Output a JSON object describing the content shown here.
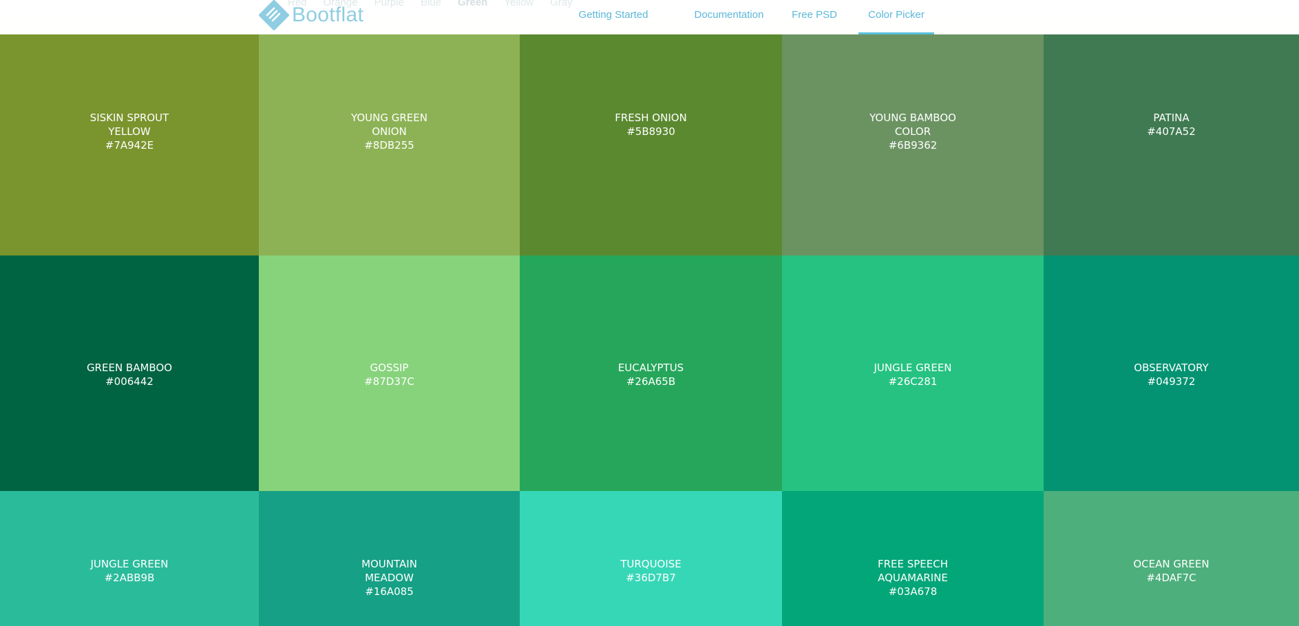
{
  "nav": {
    "brand": "Bootflat",
    "links": [
      {
        "label": "Getting Started"
      },
      {
        "label": "Documentation"
      },
      {
        "label": "Free PSD"
      },
      {
        "label": "Color Picker",
        "active": true
      }
    ],
    "filters": [
      "Red",
      "Orange",
      "Purple",
      "Blue",
      "Green",
      "Yellow",
      "Gray"
    ],
    "active_filter": "Green"
  },
  "swatches": [
    {
      "name": "SISKIN SPROUT YELLOW",
      "hex": "#7A942E"
    },
    {
      "name": "YOUNG GREEN ONION",
      "hex": "#8DB255"
    },
    {
      "name": "FRESH ONION",
      "hex": "#5B8930"
    },
    {
      "name": "YOUNG BAMBOO COLOR",
      "hex": "#6B9362"
    },
    {
      "name": "PATINA",
      "hex": "#407A52"
    },
    {
      "name": "GREEN BAMBOO",
      "hex": "#006442"
    },
    {
      "name": "GOSSIP",
      "hex": "#87D37C"
    },
    {
      "name": "EUCALYPTUS",
      "hex": "#26A65B"
    },
    {
      "name": "JUNGLE GREEN",
      "hex": "#26C281"
    },
    {
      "name": "OBSERVATORY",
      "hex": "#049372"
    },
    {
      "name": "JUNGLE GREEN",
      "hex": "#2ABB9B"
    },
    {
      "name": "MOUNTAIN MEADOW",
      "hex": "#16A085"
    },
    {
      "name": "TURQUOISE",
      "hex": "#36D7B7"
    },
    {
      "name": "FREE SPEECH AQUAMARINE",
      "hex": "#03A678"
    },
    {
      "name": "OCEAN GREEN",
      "hex": "#4DAF7C"
    }
  ],
  "colors": {
    "brand": "#8FCDE2",
    "link": "#5BB8D8",
    "active_underline": "#5BC0DE"
  }
}
